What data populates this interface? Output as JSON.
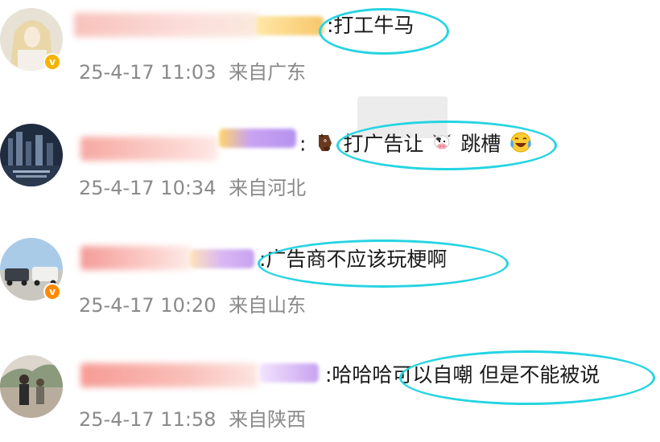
{
  "comments": [
    {
      "text": ":打工牛马",
      "time": "25-4-17 11:03",
      "location": "来自广东",
      "verified": true,
      "badge_color": "#f5b400"
    },
    {
      "prefix": ":",
      "text_a": "打广告让",
      "text_b": "跳槽",
      "time": "25-4-17 10:34",
      "location": "来自河北",
      "verified": false,
      "emoji_icons": [
        "horse-face-icon",
        "cow-face-icon",
        "laughing-crying-face-icon"
      ]
    },
    {
      "text": ":广告商不应该玩梗啊",
      "time": "25-4-17 10:20",
      "location": "来自山东",
      "verified": true,
      "badge_color": "#ff8a00"
    },
    {
      "text": ":哈哈哈可以自嘲 但是不能被说",
      "time": "25-4-17 11:58",
      "location": "来自陕西",
      "verified": false
    }
  ],
  "colors": {
    "highlight": "#25d4e2",
    "meta_text": "#8a8a8a",
    "content_text": "#1a1a1a"
  }
}
